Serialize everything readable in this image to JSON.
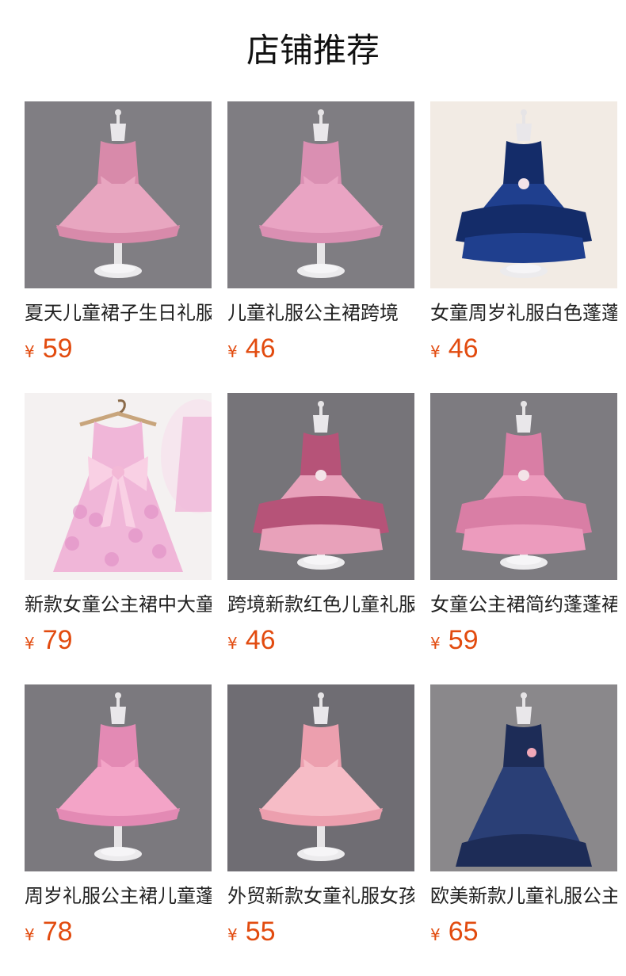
{
  "header": {
    "title": "店铺推荐"
  },
  "currency_symbol": "¥",
  "colors": {
    "price": "#e24b0f",
    "title": "#111111"
  },
  "products": [
    {
      "name": "夏天儿童裙子生日礼服",
      "price": "59",
      "image_icon": "pink-lace-tutu-dress-image",
      "bg": "#807e83",
      "dress": "#e8a6c0",
      "dress_dark": "#d88aaa",
      "style": "tutu"
    },
    {
      "name": "儿童礼服公主裙跨境",
      "price": "46",
      "image_icon": "pink-bow-tutu-dress-image",
      "bg": "#7f7d82",
      "dress": "#e9a4c3",
      "dress_dark": "#da8fb2",
      "style": "tutu"
    },
    {
      "name": "女童周岁礼服白色蓬蓬裙",
      "price": "46",
      "image_icon": "navy-layered-dress-image",
      "bg": "#f2ebe4",
      "dress": "#1f3f8e",
      "dress_dark": "#142c69",
      "style": "layered"
    },
    {
      "name": "新款女童公主裙中大童",
      "price": "79",
      "image_icon": "pink-sequin-bow-dress-image",
      "bg": "#f4f1f1",
      "dress": "#f0b6d8",
      "dress_dark": "#e08cc4",
      "style": "hanger"
    },
    {
      "name": "跨境新款红色儿童礼服",
      "price": "46",
      "image_icon": "rose-sequin-dress-image",
      "bg": "#767479",
      "dress": "#e8a1ba",
      "dress_dark": "#b65378",
      "style": "layered"
    },
    {
      "name": "女童公主裙简约蓬蓬裙",
      "price": "59",
      "image_icon": "pink-ruffle-dress-image",
      "bg": "#7d7b80",
      "dress": "#ec9bbd",
      "dress_dark": "#d97ea5",
      "style": "layered"
    },
    {
      "name": "周岁礼服公主裙儿童蓬蓬",
      "price": "78",
      "image_icon": "pink-tiered-tulle-dress-image",
      "bg": "#7b797e",
      "dress": "#f3a4c7",
      "dress_dark": "#e38ab4",
      "style": "tutu"
    },
    {
      "name": "外贸新款女童礼服女孩",
      "price": "55",
      "image_icon": "peach-tulle-dress-image",
      "bg": "#6f6d73",
      "dress": "#f6bcc6",
      "dress_dark": "#ec9fae",
      "style": "tutu"
    },
    {
      "name": "欧美新款儿童礼服公主裙",
      "price": "65",
      "image_icon": "navy-long-gown-image",
      "bg": "#8a888b",
      "dress": "#2a3f76",
      "dress_dark": "#1d2c57",
      "style": "gown"
    }
  ]
}
